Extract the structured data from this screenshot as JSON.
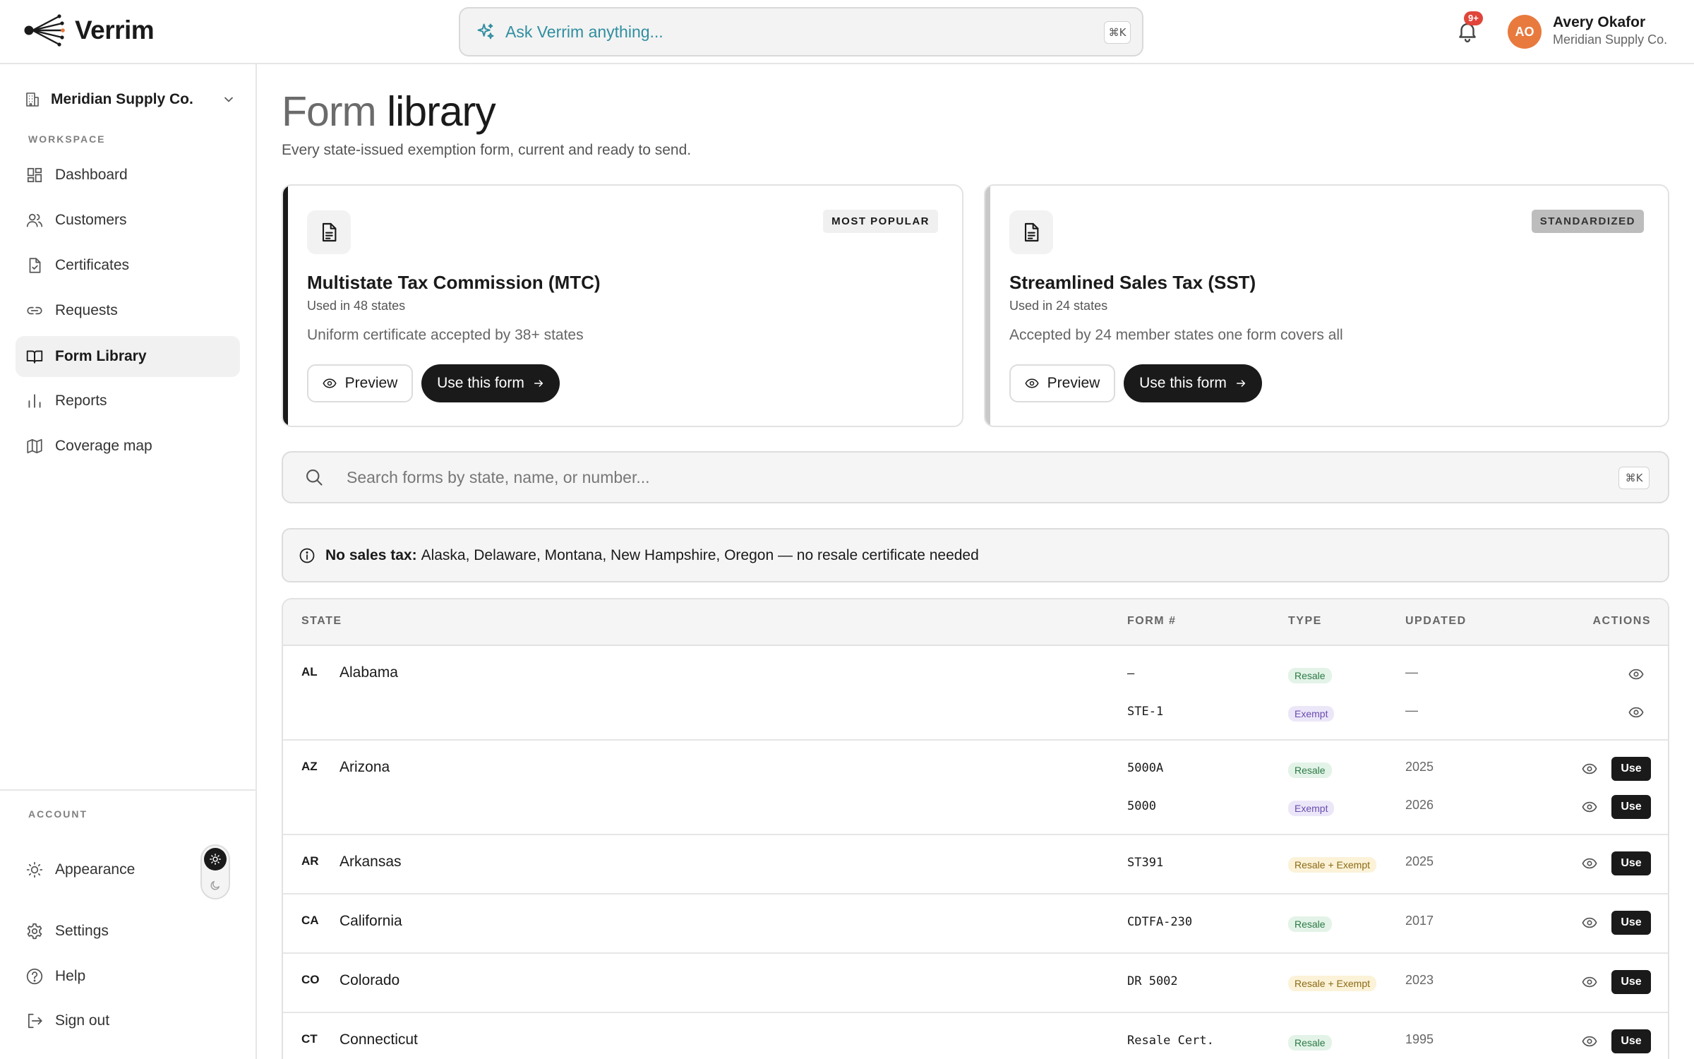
{
  "app": {
    "name": "Verrim"
  },
  "header": {
    "ask_placeholder": "Ask Verrim anything...",
    "ask_shortcut": "⌘K",
    "notification_badge": "9+",
    "user": {
      "initials": "AO",
      "name": "Avery Okafor",
      "org": "Meridian Supply Co."
    }
  },
  "sidebar": {
    "org_name": "Meridian Supply Co.",
    "workspace_label": "WORKSPACE",
    "items": [
      {
        "label": "Dashboard",
        "icon": "dashboard-icon"
      },
      {
        "label": "Customers",
        "icon": "users-icon"
      },
      {
        "label": "Certificates",
        "icon": "certificate-icon"
      },
      {
        "label": "Requests",
        "icon": "link-icon"
      },
      {
        "label": "Form Library",
        "icon": "book-icon",
        "active": true
      },
      {
        "label": "Reports",
        "icon": "bar-chart-icon"
      },
      {
        "label": "Coverage map",
        "icon": "map-icon"
      }
    ],
    "account_label": "ACCOUNT",
    "account_items": [
      {
        "label": "Appearance",
        "icon": "sun-icon"
      },
      {
        "label": "Settings",
        "icon": "gear-icon"
      },
      {
        "label": "Help",
        "icon": "help-icon"
      },
      {
        "label": "Sign out",
        "icon": "sign-out-icon"
      }
    ]
  },
  "main": {
    "title_part1": "Form",
    "title_part2": "library",
    "subtitle": "Every state-issued exemption form, current and ready to send.",
    "featured": [
      {
        "badge": "MOST POPULAR",
        "title": "Multistate Tax Commission (MTC)",
        "usage": "Used in 48 states",
        "description": "Uniform certificate accepted by 38+ states",
        "preview_label": "Preview",
        "use_label": "Use this form"
      },
      {
        "badge": "STANDARDIZED",
        "title": "Streamlined Sales Tax (SST)",
        "usage": "Used in 24 states",
        "description": "Accepted by 24 member states one form covers all",
        "preview_label": "Preview",
        "use_label": "Use this form"
      }
    ],
    "search": {
      "placeholder": "Search forms by state, name, or number...",
      "shortcut": "⌘K"
    },
    "notice": {
      "bold": "No sales tax:",
      "text": "Alaska, Delaware, Montana, New Hampshire, Oregon — no resale certificate needed"
    },
    "table": {
      "columns": [
        "STATE",
        "FORM #",
        "TYPE",
        "UPDATED",
        "ACTIONS"
      ],
      "use_label": "Use",
      "rows": [
        {
          "abbr": "AL",
          "state": "Alabama",
          "forms": [
            {
              "number": "—",
              "type": "Resale",
              "updated": "—",
              "use": false
            },
            {
              "number": "STE-1",
              "type": "Exempt",
              "updated": "—",
              "use": false
            }
          ]
        },
        {
          "abbr": "AZ",
          "state": "Arizona",
          "forms": [
            {
              "number": "5000A",
              "type": "Resale",
              "updated": "2025",
              "use": true
            },
            {
              "number": "5000",
              "type": "Exempt",
              "updated": "2026",
              "use": true
            }
          ]
        },
        {
          "abbr": "AR",
          "state": "Arkansas",
          "forms": [
            {
              "number": "ST391",
              "type": "Resale + Exempt",
              "updated": "2025",
              "use": true
            }
          ]
        },
        {
          "abbr": "CA",
          "state": "California",
          "forms": [
            {
              "number": "CDTFA-230",
              "type": "Resale",
              "updated": "2017",
              "use": true
            }
          ]
        },
        {
          "abbr": "CO",
          "state": "Colorado",
          "forms": [
            {
              "number": "DR 5002",
              "type": "Resale + Exempt",
              "updated": "2023",
              "use": true
            }
          ]
        },
        {
          "abbr": "CT",
          "state": "Connecticut",
          "forms": [
            {
              "number": "Resale Cert.",
              "type": "Resale",
              "updated": "1995",
              "use": true
            }
          ]
        }
      ]
    }
  },
  "colors": {
    "accent": "#1a1a1a",
    "brand_orange": "#e87a3e",
    "ask_teal": "#2f8ea0",
    "badge_red": "#e0453a"
  }
}
